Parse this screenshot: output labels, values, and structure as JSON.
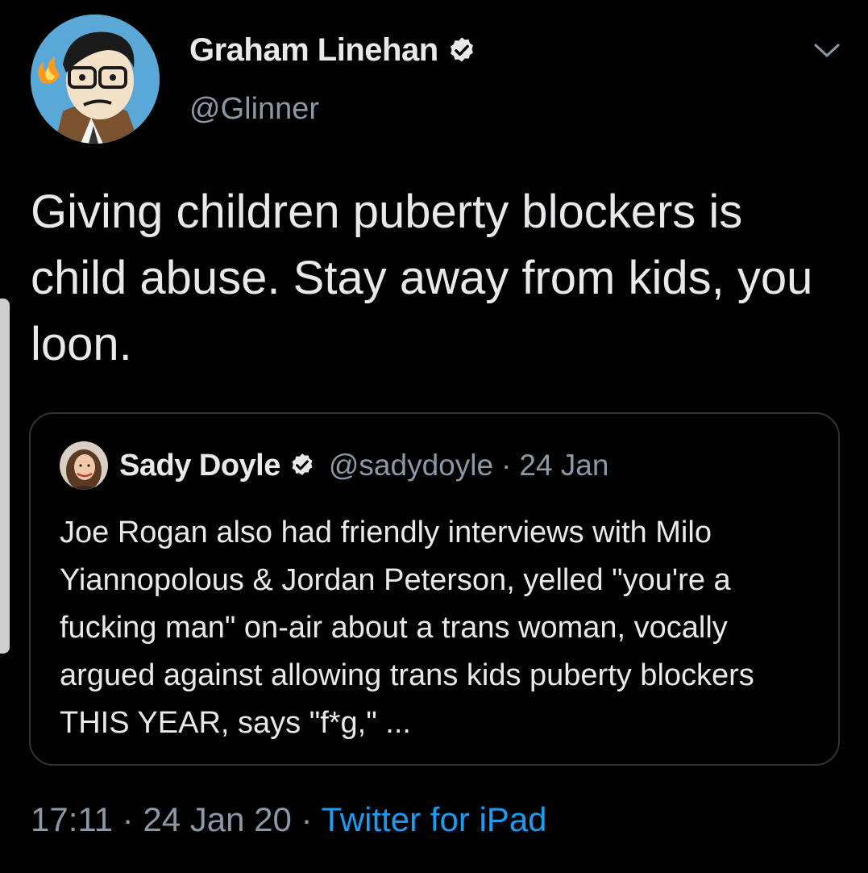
{
  "author": {
    "display_name": "Graham Linehan",
    "handle": "@Glinner",
    "verified": true,
    "avatar_icon": "cartoon-avatar-icon"
  },
  "tweet": {
    "text": "Giving children puberty blockers is child abuse. Stay away from kids, you loon."
  },
  "quoted_tweet": {
    "display_name": "Sady Doyle",
    "handle": "@sadydoyle",
    "separator": "·",
    "date": "24 Jan",
    "verified": true,
    "text": "Joe Rogan also had friendly interviews with Milo Yiannopolous & Jordan Peterson, yelled \"you're a fucking man\" on-air about a trans woman, vocally argued against allowing trans kids puberty blockers THIS YEAR, says \"f*g,\" ..."
  },
  "meta": {
    "time": "17:11",
    "separator1": "·",
    "date": "24 Jan 20",
    "separator2": "·",
    "source": "Twitter for iPad"
  },
  "colors": {
    "background": "#000000",
    "text_primary": "#e7e9ea",
    "text_secondary": "#8b98a5",
    "link": "#1d9bf0",
    "border": "#2f3336"
  }
}
